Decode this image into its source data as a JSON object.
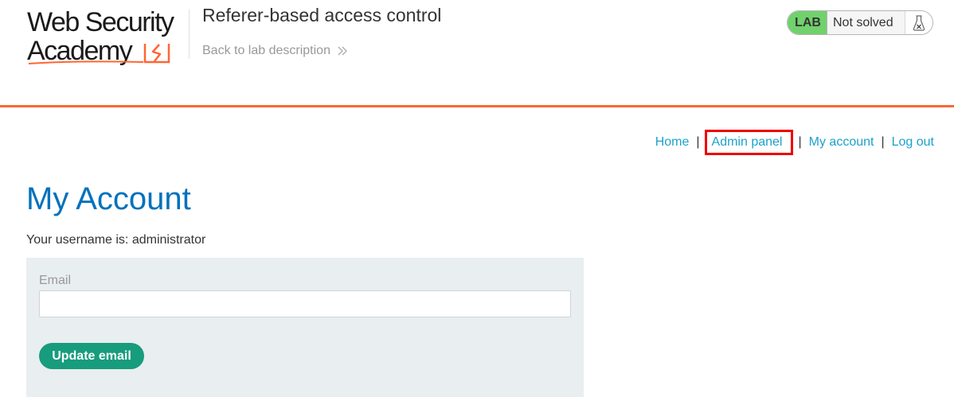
{
  "header": {
    "logo_line1": "Web Security",
    "logo_line2": "Academy",
    "lab_title": "Referer-based access control",
    "back_link": "Back to lab description",
    "status_badge": "LAB",
    "status_text": "Not solved",
    "accent_color": "#ff6633"
  },
  "nav": {
    "home": "Home",
    "admin_panel": "Admin panel",
    "my_account": "My account",
    "log_out": "Log out",
    "separator": "|"
  },
  "main": {
    "heading": "My Account",
    "username_text": "Your username is: administrator",
    "email_label": "Email",
    "email_value": "",
    "update_button": "Update email"
  },
  "colors": {
    "link": "#1da1cc",
    "heading": "#0071bc",
    "button": "#179c7d",
    "lab_badge": "#70d16d",
    "highlight_box": "#ee0000"
  },
  "icons": {
    "logo_mark": "lightning-bracket-icon",
    "back_chevron": "double-chevron-right-icon",
    "lab_status": "flask-icon"
  }
}
